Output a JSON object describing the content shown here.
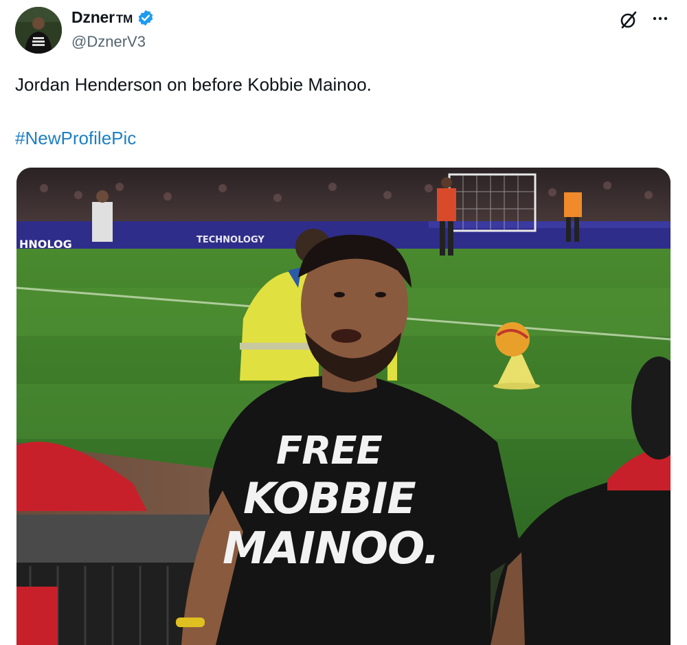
{
  "post": {
    "author": {
      "display_name": "Dzner",
      "badge_suffix": "TM",
      "handle": "@DznerV3",
      "verified": true,
      "avatar_icon": "profile-photo"
    },
    "text": "Jordan Henderson on before Kobbie Mainoo.",
    "hashtag": "#NewProfilePic",
    "actions": {
      "grok_icon": "grok-icon",
      "more_icon": "more-options-icon"
    },
    "media": {
      "shirt_lines": [
        "FREE",
        "KOBBIE",
        "MAINOO."
      ],
      "board_text_left": "HNOLOG",
      "board_text_mid": "TECHNOLOGY"
    }
  },
  "colors": {
    "hashtag": "#1d7fc4",
    "verified_badge": "#1d9bf0",
    "handle_gray": "#536471"
  }
}
